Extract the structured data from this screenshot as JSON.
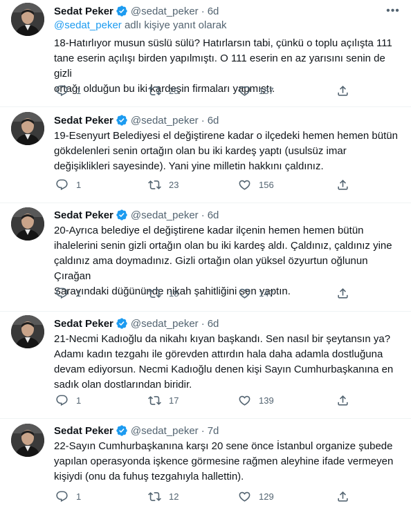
{
  "colors": {
    "accent": "#1d9bf0",
    "muted": "#536471",
    "text": "#0f1419",
    "divider": "#eff3f4"
  },
  "tweets": [
    {
      "author": "Sedat Peker",
      "handle": "@sedat_peker",
      "separator": "·",
      "time": "6d",
      "reply_prefix": "@sedat_peker",
      "reply_suffix": " adlı kişiye yanıt olarak",
      "text": "18-Hatırlıyor musun süslü sülü?  Hatırlarsın tabi, çünkü o toplu açılışta 111\ntane eserin açılışı birden yapılmıştı. O 111 eserin en az yarısını senin de gizli\nortağı olduğun bu iki kardeşin firmaları yapmıştı.",
      "replies": "1",
      "retweets": "25",
      "likes": "187"
    },
    {
      "author": "Sedat Peker",
      "handle": "@sedat_peker",
      "separator": "·",
      "time": "6d",
      "text": "19-Esenyurt Belediyesi el değiştirene kadar o ilçedeki hemen hemen bütün\ngökdelenleri senin ortağın olan bu iki kardeş yaptı (usulsüz imar\ndeğişiklikleri sayesinde). Yani yine milletin hakkını çaldınız.",
      "replies": "1",
      "retweets": "23",
      "likes": "156"
    },
    {
      "author": "Sedat Peker",
      "handle": "@sedat_peker",
      "separator": "·",
      "time": "6d",
      "text": "20-Ayrıca belediye el değiştirene kadar ilçenin hemen hemen bütün\nihalelerini senin gizli ortağın olan bu iki kardeş aldı. Çaldınız, çaldınız yine\nçaldınız ama doymadınız. Gizli ortağın olan yüksel özyurtun oğlunun Çırağan\nSarayındaki düğününde nikah şahitliğini sen yaptın.",
      "replies": "1",
      "retweets": "18",
      "likes": "147"
    },
    {
      "author": "Sedat Peker",
      "handle": "@sedat_peker",
      "separator": "·",
      "time": "6d",
      "text": "21-Necmi Kadıoğlu da nikahı kıyan başkandı. Sen nasıl bir şeytansın ya?\nAdamı kadın tezgahı ile görevden attırdın hala daha adamla dostluğuna\ndevam ediyorsun. Necmi Kadıoğlu denen kişi Sayın Cumhurbaşkanına en\nsadık olan dostlarından biridir.",
      "replies": "1",
      "retweets": "17",
      "likes": "139"
    },
    {
      "author": "Sedat Peker",
      "handle": "@sedat_peker",
      "separator": "·",
      "time": "7d",
      "text": "22-Sayın Cumhurbaşkanına karşı 20 sene önce İstanbul organize şubede\nyapılan operasyonda işkence görmesine rağmen aleyhine ifade vermeyen\nkişiydi (onu da  fuhuş tezgahıyla hallettin).",
      "replies": "1",
      "retweets": "12",
      "likes": "129"
    }
  ]
}
